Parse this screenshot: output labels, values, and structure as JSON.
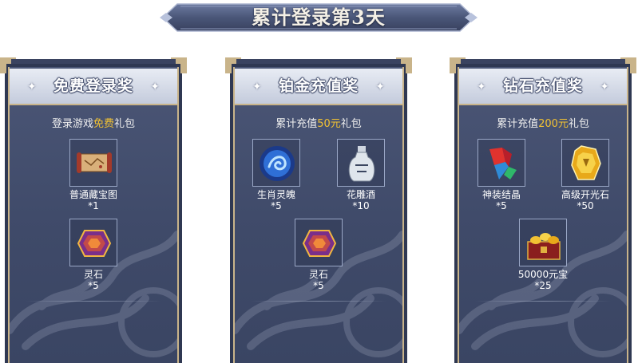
{
  "banner": {
    "title": "累计登录第3天"
  },
  "panels": [
    {
      "title": "免费登录奖",
      "subtitle_prefix": "登录游戏",
      "subtitle_highlight": "免费",
      "subtitle_suffix": "礼包",
      "items": [
        {
          "name": "普通藏宝图",
          "count": "*1",
          "icon": "treasure-map-icon"
        },
        {
          "name": "灵石",
          "count": "*5",
          "icon": "spirit-stone-icon"
        }
      ]
    },
    {
      "title": "铂金充值奖",
      "subtitle_prefix": "累计充值",
      "subtitle_highlight": "50元",
      "subtitle_suffix": "礼包",
      "items": [
        {
          "name": "生肖灵魄",
          "count": "*5",
          "icon": "zodiac-soul-icon"
        },
        {
          "name": "花雕酒",
          "count": "*10",
          "icon": "wine-jar-icon"
        },
        {
          "name": "灵石",
          "count": "*5",
          "icon": "spirit-stone-icon"
        }
      ]
    },
    {
      "title": "钻石充值奖",
      "subtitle_prefix": "累计充值",
      "subtitle_highlight": "200元",
      "subtitle_suffix": "礼包",
      "items": [
        {
          "name": "神装结晶",
          "count": "*5",
          "icon": "divine-crystal-icon"
        },
        {
          "name": "高级开光石",
          "count": "*50",
          "icon": "advanced-blessing-stone-icon"
        },
        {
          "name": "50000元宝",
          "count": "*25",
          "icon": "gold-ingot-chest-icon"
        }
      ]
    }
  ],
  "colors": {
    "highlight": "#f2c233",
    "panel_bg": "#4b5676",
    "frame_gold": "#c9b48a"
  }
}
